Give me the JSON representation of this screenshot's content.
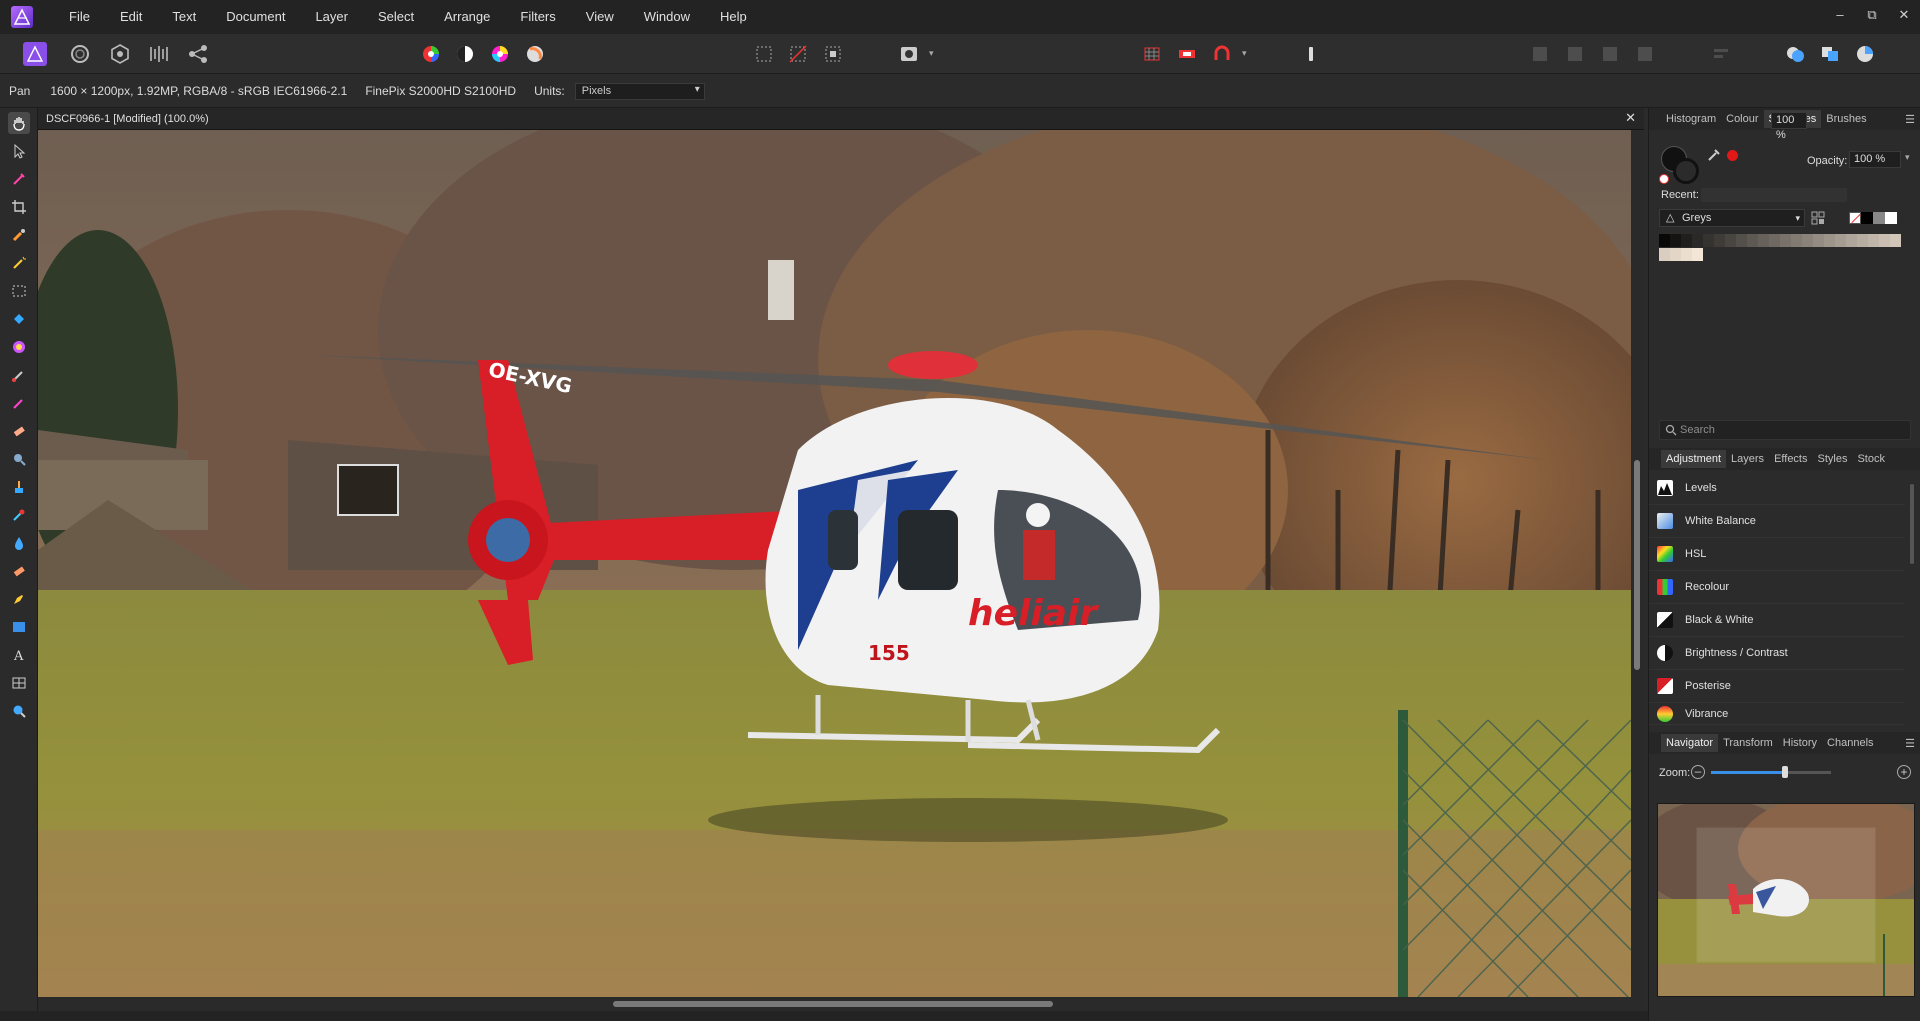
{
  "app": {
    "name": "Affinity Photo"
  },
  "menu": {
    "items": [
      "File",
      "Edit",
      "Text",
      "Document",
      "Layer",
      "Select",
      "Arrange",
      "Filters",
      "View",
      "Window",
      "Help"
    ]
  },
  "window_controls": {
    "minimize": "–",
    "restore": "⧉",
    "close": "✕"
  },
  "context": {
    "tool_name": "Pan",
    "image_info": "1600 × 1200px, 1.92MP, RGBA/8 - sRGB IEC61966-2.1",
    "camera": "FinePix S2000HD S2100HD",
    "units_label": "Units:",
    "units_value": "Pixels"
  },
  "document": {
    "title": "DSCF0966-1 [Modified] (100.0%)",
    "close_glyph": "✕",
    "helicopter_text": {
      "brand": "heliair",
      "number": "155",
      "registration": "OE-XVG"
    }
  },
  "colour_panel": {
    "tabs": [
      "Histogram",
      "Colour",
      "Swatches",
      "Brushes"
    ],
    "active_tab": "Swatches",
    "opacity_label": "Opacity:",
    "opacity_value": "100 %",
    "recent_label": "Recent:",
    "palette_name": "Greys",
    "accent_red": "#e01818"
  },
  "search": {
    "placeholder": "Search"
  },
  "studio_panel": {
    "tabs": [
      "Adjustment",
      "Layers",
      "Effects",
      "Styles",
      "Stock"
    ],
    "active_tab": "Adjustment",
    "adjustments": [
      "Levels",
      "White Balance",
      "HSL",
      "Recolour",
      "Black & White",
      "Brightness / Contrast",
      "Posterise",
      "Vibrance"
    ]
  },
  "navigator_panel": {
    "tabs": [
      "Navigator",
      "Transform",
      "History",
      "Channels"
    ],
    "active_tab": "Navigator",
    "zoom_label": "Zoom:",
    "zoom_value": "100 %",
    "zoom_fraction": 0.62
  }
}
